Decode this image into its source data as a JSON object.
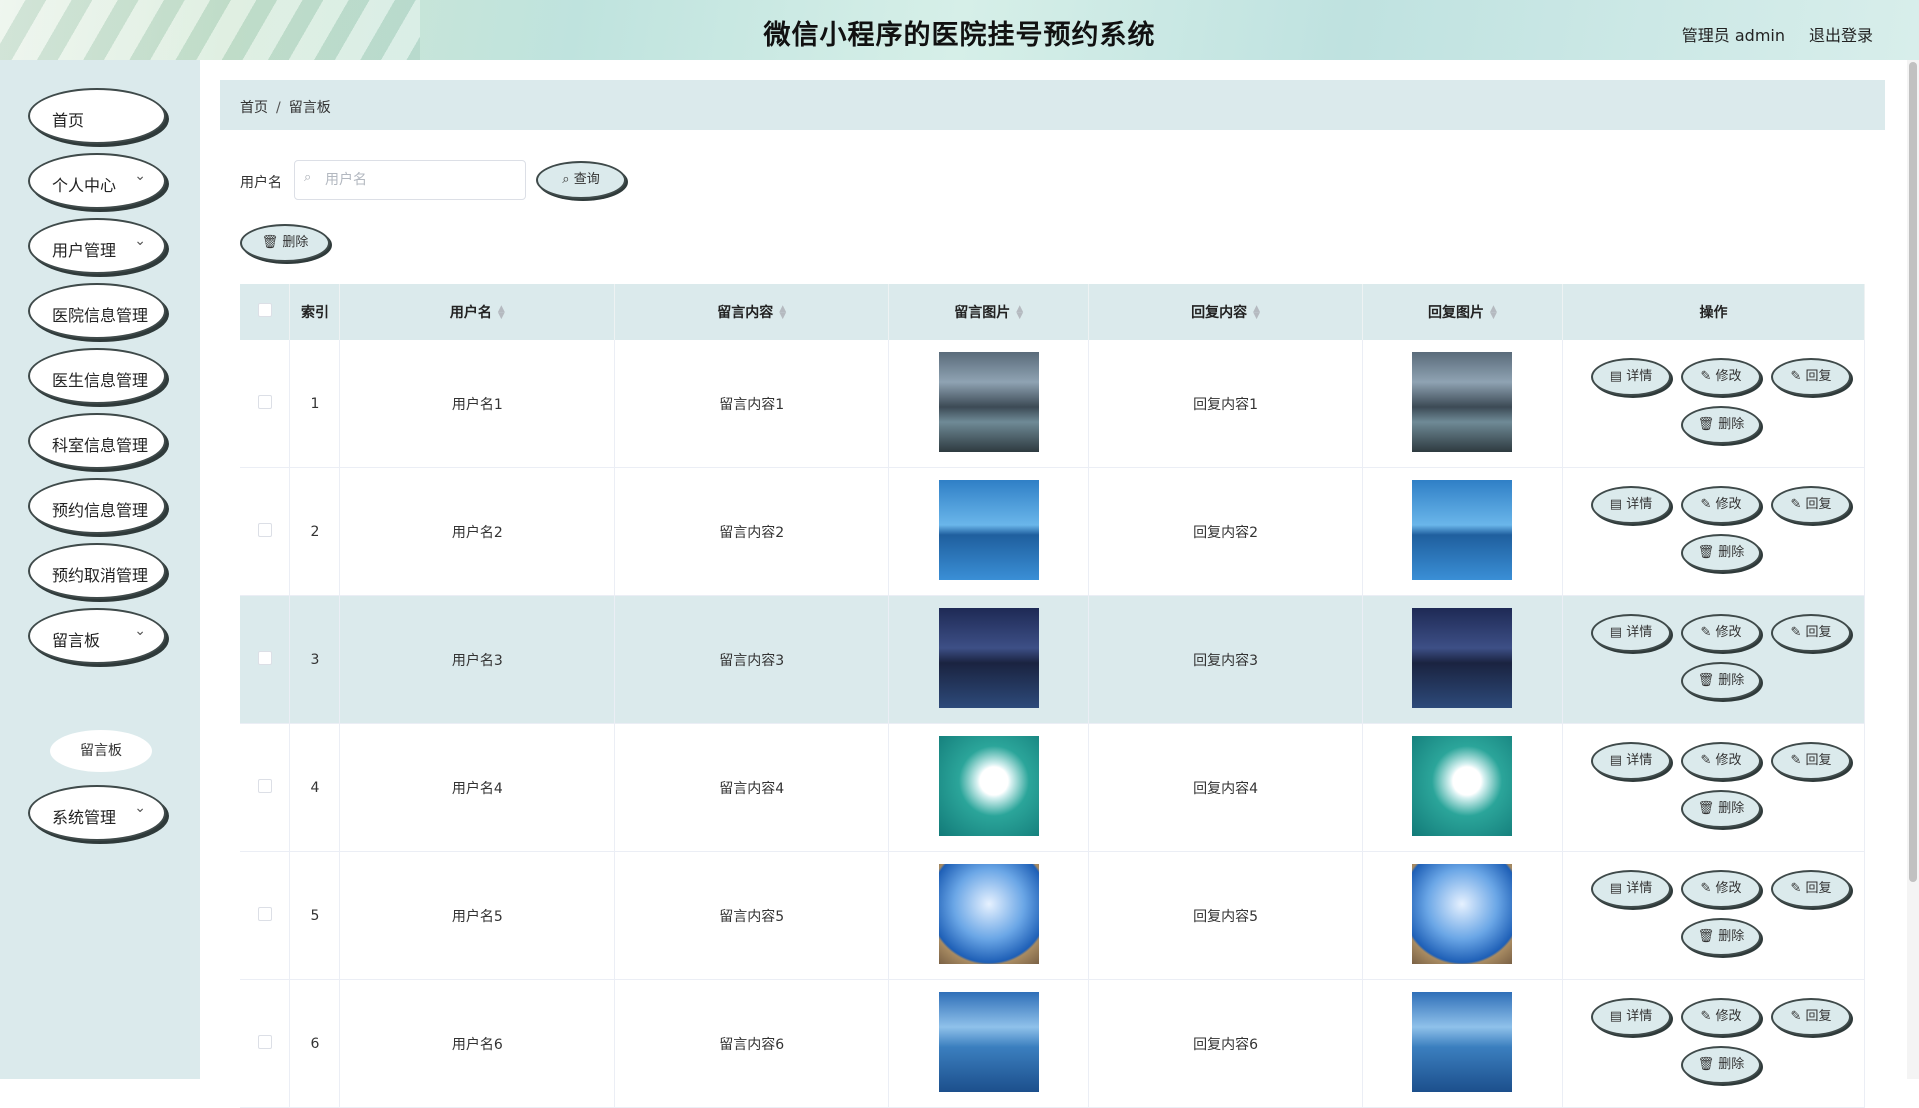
{
  "header": {
    "title": "微信小程序的医院挂号预约系统",
    "admin": "管理员 admin",
    "logout": "退出登录"
  },
  "sidebar": {
    "items": [
      {
        "label": "首页",
        "has_children": false
      },
      {
        "label": "个人中心",
        "has_children": true
      },
      {
        "label": "用户管理",
        "has_children": true
      },
      {
        "label": "医院信息管理",
        "has_children": false
      },
      {
        "label": "医生信息管理",
        "has_children": false
      },
      {
        "label": "科室信息管理",
        "has_children": false
      },
      {
        "label": "预约信息管理",
        "has_children": false
      },
      {
        "label": "预约取消管理",
        "has_children": false
      },
      {
        "label": "留言板",
        "has_children": true
      },
      {
        "label": "系统管理",
        "has_children": true
      }
    ],
    "sub_item": "留言板"
  },
  "breadcrumb": {
    "home": "首页",
    "sep": "/",
    "current": "留言板"
  },
  "search": {
    "label": "用户名",
    "placeholder": "用户名",
    "value": "",
    "query_button": "查询",
    "search_icon": "search-icon"
  },
  "actions": {
    "batch_delete": "删除",
    "delete_icon": "trash-icon"
  },
  "table": {
    "headers": {
      "index": "索引",
      "username": "用户名",
      "content": "留言内容",
      "image": "留言图片",
      "reply": "回复内容",
      "reply_image": "回复图片",
      "ops": "操作"
    },
    "rows": [
      {
        "index": "1",
        "username": "用户名1",
        "content": "留言内容1",
        "reply": "回复内容1",
        "image": "mountain-river"
      },
      {
        "index": "2",
        "username": "用户名2",
        "content": "留言内容2",
        "reply": "回复内容2",
        "image": "lake-tree"
      },
      {
        "index": "3",
        "username": "用户名3",
        "content": "留言内容3",
        "reply": "回复内容3",
        "image": "night-lake"
      },
      {
        "index": "4",
        "username": "用户名4",
        "content": "留言内容4",
        "reply": "回复内容4",
        "image": "white-flower"
      },
      {
        "index": "5",
        "username": "用户名5",
        "content": "留言内容5",
        "reply": "回复内容5",
        "image": "blue-sky-person"
      },
      {
        "index": "6",
        "username": "用户名6",
        "content": "留言内容6",
        "reply": "回复内容6",
        "image": "mirror-lake"
      }
    ],
    "row_buttons": {
      "detail": "详情",
      "edit": "修改",
      "reply": "回复",
      "delete": "删除"
    }
  },
  "colors": {
    "accent": "#dbeaec",
    "border": "#3f4a4a",
    "highlight_row": "#dbeaec"
  }
}
